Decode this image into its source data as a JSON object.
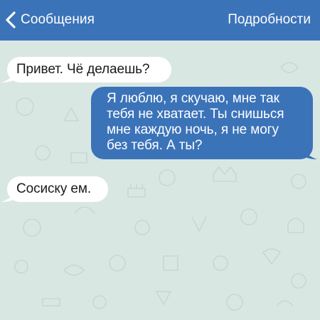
{
  "navbar": {
    "back_label": "Сообщения",
    "details_label": "Подробности",
    "background": "#3b73b9",
    "back_icon": "chevron-left-icon"
  },
  "conversation": {
    "background": "#d9e7e3",
    "messages": [
      {
        "direction": "incoming",
        "text": "Привет. Чё делаешь?"
      },
      {
        "direction": "outgoing",
        "text": "Я люблю, я скучаю, мне так тебя не хватает. Ты снишься мне каждую ночь, я не могу без тебя. А ты?"
      },
      {
        "direction": "incoming",
        "text": "Сосиску ем."
      }
    ],
    "incoming_color": "#ffffff",
    "outgoing_color": "#3b73b9"
  }
}
